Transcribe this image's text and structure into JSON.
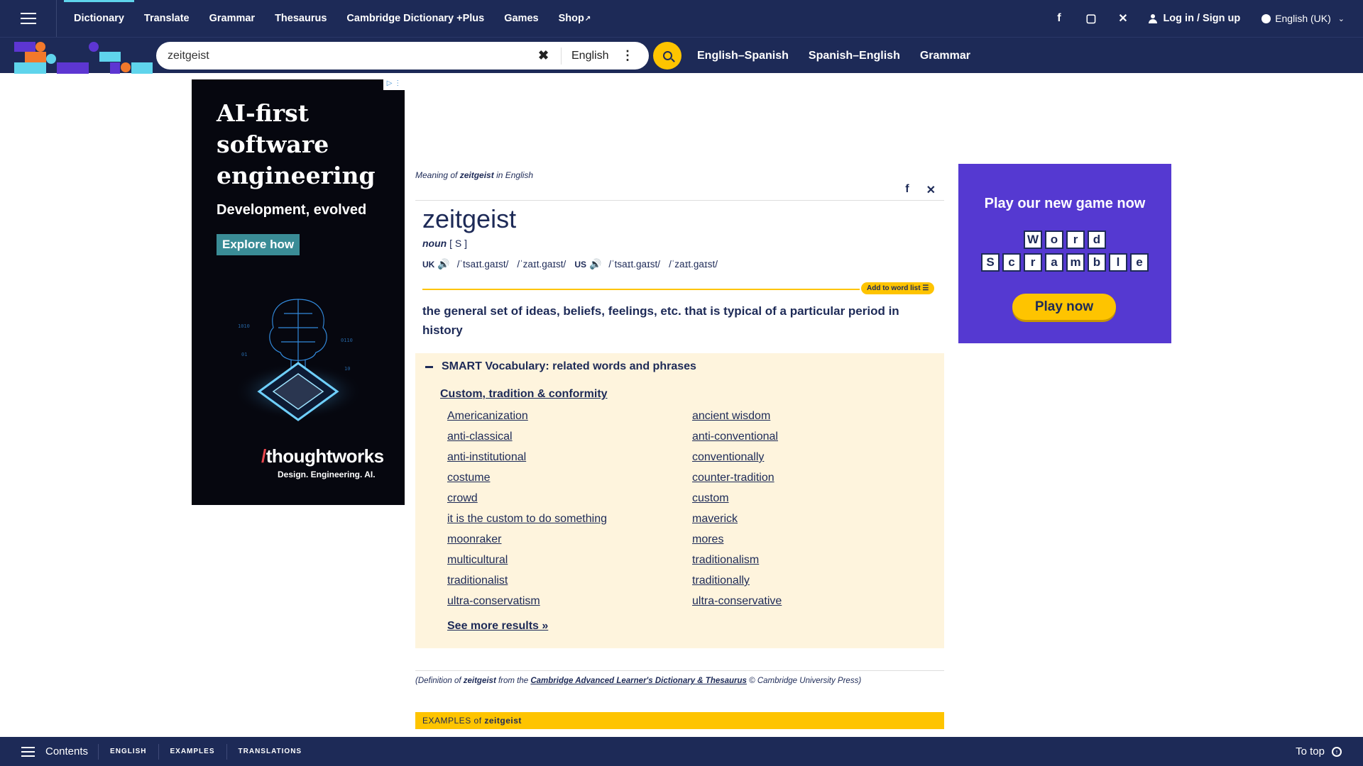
{
  "nav": {
    "items": [
      "Dictionary",
      "Translate",
      "Grammar",
      "Thesaurus",
      "Cambridge Dictionary +Plus",
      "Games",
      "Shop"
    ],
    "login": "Log in / Sign up",
    "language": "English (UK)"
  },
  "search": {
    "value": "zeitgeist",
    "language": "English",
    "quick_links": [
      "English–Spanish",
      "Spanish–English",
      "Grammar"
    ]
  },
  "ad_left": {
    "title_line1": "AI-first",
    "title_line2": "software",
    "title_line3": "engineering",
    "subtitle": "Development, evolved",
    "cta": "Explore how",
    "brand": "thoughtworks",
    "tagline": "Design. Engineering. AI."
  },
  "ad_right": {
    "headline": "Play our new game now",
    "word1": [
      "W",
      "o",
      "r",
      "d"
    ],
    "word2": [
      "S",
      "c",
      "r",
      "a",
      "m",
      "b",
      "l",
      "e"
    ],
    "cta": "Play now"
  },
  "entry": {
    "meaning_prefix": "Meaning of ",
    "word": "zeitgeist",
    "meaning_suffix": " in English",
    "pos": "noun",
    "grammar": "[ S ]",
    "uk_label": "UK",
    "uk_ipa1": "/ˈtsaɪt.ɡaɪst/",
    "uk_ipa2": "/ˈzaɪt.ɡaɪst/",
    "us_label": "US",
    "us_ipa1": "/ˈtsaɪt.ɡaɪst/",
    "us_ipa2": "/ˈzaɪt.ɡaɪst/",
    "add_to_list": "Add to word list",
    "definition": "the general set of ideas, beliefs, feelings, etc. that is typical of a particular period in history"
  },
  "smart_vocab": {
    "title": "SMART Vocabulary: related words and phrases",
    "category": "Custom, tradition & conformity",
    "left": [
      "Americanization",
      "anti-classical",
      "anti-institutional",
      "costume",
      "crowd",
      "it is the custom to do something",
      "moonraker",
      "multicultural",
      "traditionalist",
      "ultra-conservatism"
    ],
    "right": [
      "ancient wisdom",
      "anti-conventional",
      "conventionally",
      "counter-tradition",
      "custom",
      "maverick",
      "mores",
      "traditionalism",
      "traditionally",
      "ultra-conservative"
    ],
    "see_more": "See more results »"
  },
  "source": {
    "prefix": "(Definition of ",
    "word": "zeitgeist",
    "middle": " from the ",
    "book": "Cambridge Advanced Learner's Dictionary & Thesaurus",
    "suffix": " © Cambridge University Press)"
  },
  "examples": {
    "prefix": "EXAMPLES of ",
    "word": "zeitgeist"
  },
  "bottom": {
    "contents": "Contents",
    "tabs": [
      "ENGLISH",
      "EXAMPLES",
      "TRANSLATIONS"
    ],
    "to_top": "To top"
  }
}
